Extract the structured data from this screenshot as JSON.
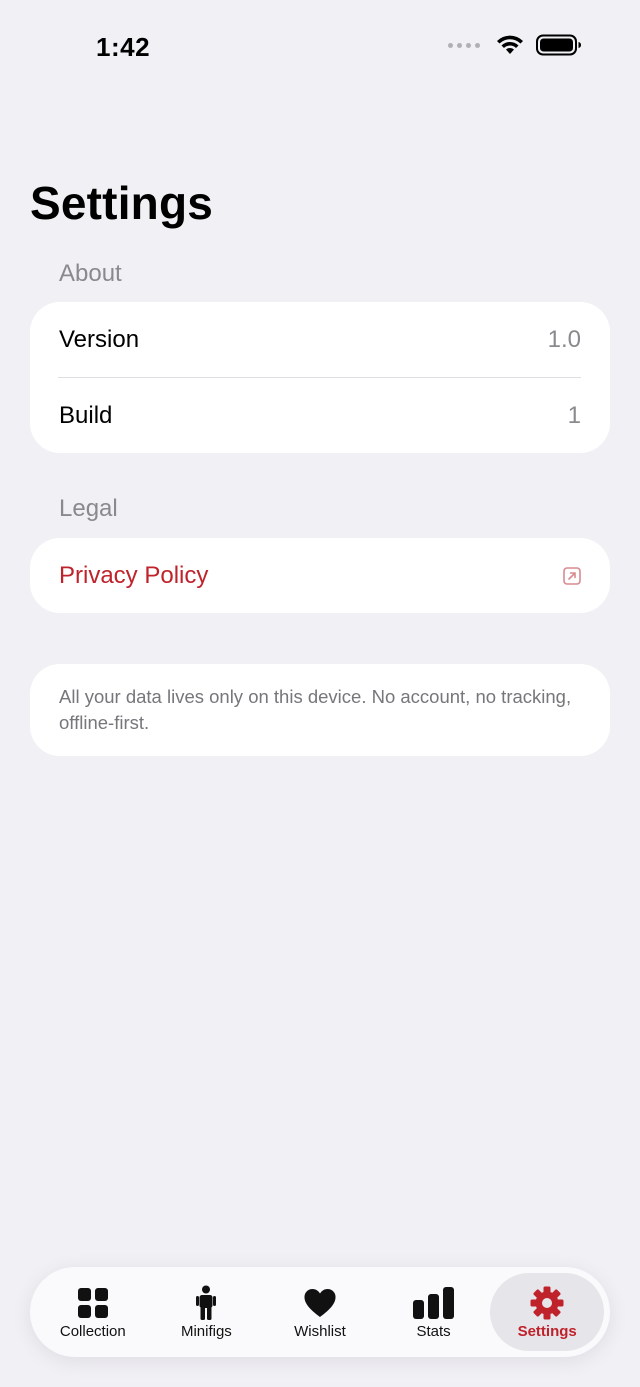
{
  "status_bar": {
    "time": "1:42"
  },
  "page": {
    "title": "Settings"
  },
  "sections": {
    "about": {
      "header": "About",
      "version": {
        "label": "Version",
        "value": "1.0"
      },
      "build": {
        "label": "Build",
        "value": "1"
      }
    },
    "legal": {
      "header": "Legal",
      "privacy": {
        "label": "Privacy Policy",
        "icon": "external-link-icon"
      }
    },
    "note": "All your data lives only on this device. No account, no tracking, offline-first."
  },
  "tabs": [
    {
      "label": "Collection",
      "icon": "grid-icon",
      "active": false
    },
    {
      "label": "Minifigs",
      "icon": "person-icon",
      "active": false
    },
    {
      "label": "Wishlist",
      "icon": "heart-icon",
      "active": false
    },
    {
      "label": "Stats",
      "icon": "bar-chart-icon",
      "active": false
    },
    {
      "label": "Settings",
      "icon": "gear-icon",
      "active": true
    }
  ],
  "colors": {
    "accent": "#c0222c",
    "background": "#f1f0f5",
    "card": "#ffffff",
    "secondary_text": "#8a8a8e"
  }
}
